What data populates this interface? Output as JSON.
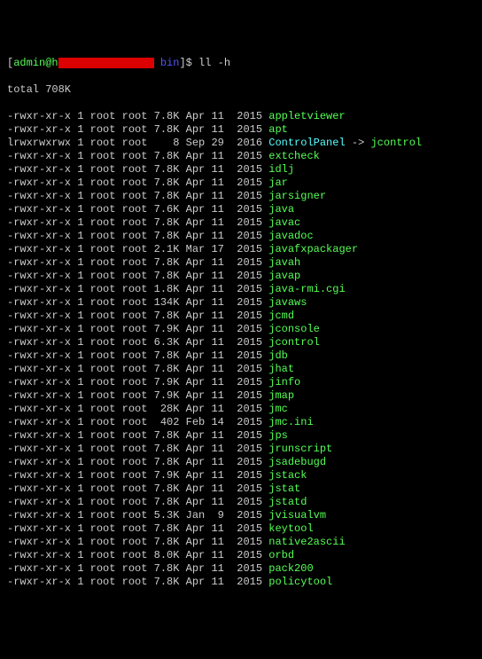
{
  "prompt": {
    "user": "admin",
    "at": "@",
    "host_prefix": "h",
    "path": "bin",
    "symbol": "$",
    "command": "ll -h"
  },
  "total": "total 708K",
  "rows": [
    {
      "perm": "-rwxr-xr-x",
      "links": "1",
      "owner": "root",
      "group": "root",
      "size": "7.8K",
      "mon": "Apr",
      "day": "11",
      "year": "2015",
      "name": "appletviewer",
      "type": "exec"
    },
    {
      "perm": "-rwxr-xr-x",
      "links": "1",
      "owner": "root",
      "group": "root",
      "size": "7.8K",
      "mon": "Apr",
      "day": "11",
      "year": "2015",
      "name": "apt",
      "type": "exec"
    },
    {
      "perm": "lrwxrwxrwx",
      "links": "1",
      "owner": "root",
      "group": "root",
      "size": "8",
      "mon": "Sep",
      "day": "29",
      "year": "2016",
      "name": "ControlPanel",
      "type": "link",
      "target": "jcontrol"
    },
    {
      "perm": "-rwxr-xr-x",
      "links": "1",
      "owner": "root",
      "group": "root",
      "size": "7.8K",
      "mon": "Apr",
      "day": "11",
      "year": "2015",
      "name": "extcheck",
      "type": "exec"
    },
    {
      "perm": "-rwxr-xr-x",
      "links": "1",
      "owner": "root",
      "group": "root",
      "size": "7.8K",
      "mon": "Apr",
      "day": "11",
      "year": "2015",
      "name": "idlj",
      "type": "exec"
    },
    {
      "perm": "-rwxr-xr-x",
      "links": "1",
      "owner": "root",
      "group": "root",
      "size": "7.8K",
      "mon": "Apr",
      "day": "11",
      "year": "2015",
      "name": "jar",
      "type": "exec"
    },
    {
      "perm": "-rwxr-xr-x",
      "links": "1",
      "owner": "root",
      "group": "root",
      "size": "7.8K",
      "mon": "Apr",
      "day": "11",
      "year": "2015",
      "name": "jarsigner",
      "type": "exec"
    },
    {
      "perm": "-rwxr-xr-x",
      "links": "1",
      "owner": "root",
      "group": "root",
      "size": "7.6K",
      "mon": "Apr",
      "day": "11",
      "year": "2015",
      "name": "java",
      "type": "exec"
    },
    {
      "perm": "-rwxr-xr-x",
      "links": "1",
      "owner": "root",
      "group": "root",
      "size": "7.8K",
      "mon": "Apr",
      "day": "11",
      "year": "2015",
      "name": "javac",
      "type": "exec"
    },
    {
      "perm": "-rwxr-xr-x",
      "links": "1",
      "owner": "root",
      "group": "root",
      "size": "7.8K",
      "mon": "Apr",
      "day": "11",
      "year": "2015",
      "name": "javadoc",
      "type": "exec"
    },
    {
      "perm": "-rwxr-xr-x",
      "links": "1",
      "owner": "root",
      "group": "root",
      "size": "2.1K",
      "mon": "Mar",
      "day": "17",
      "year": "2015",
      "name": "javafxpackager",
      "type": "exec"
    },
    {
      "perm": "-rwxr-xr-x",
      "links": "1",
      "owner": "root",
      "group": "root",
      "size": "7.8K",
      "mon": "Apr",
      "day": "11",
      "year": "2015",
      "name": "javah",
      "type": "exec"
    },
    {
      "perm": "-rwxr-xr-x",
      "links": "1",
      "owner": "root",
      "group": "root",
      "size": "7.8K",
      "mon": "Apr",
      "day": "11",
      "year": "2015",
      "name": "javap",
      "type": "exec"
    },
    {
      "perm": "-rwxr-xr-x",
      "links": "1",
      "owner": "root",
      "group": "root",
      "size": "1.8K",
      "mon": "Apr",
      "day": "11",
      "year": "2015",
      "name": "java-rmi.cgi",
      "type": "exec"
    },
    {
      "perm": "-rwxr-xr-x",
      "links": "1",
      "owner": "root",
      "group": "root",
      "size": "134K",
      "mon": "Apr",
      "day": "11",
      "year": "2015",
      "name": "javaws",
      "type": "exec"
    },
    {
      "perm": "-rwxr-xr-x",
      "links": "1",
      "owner": "root",
      "group": "root",
      "size": "7.8K",
      "mon": "Apr",
      "day": "11",
      "year": "2015",
      "name": "jcmd",
      "type": "exec"
    },
    {
      "perm": "-rwxr-xr-x",
      "links": "1",
      "owner": "root",
      "group": "root",
      "size": "7.9K",
      "mon": "Apr",
      "day": "11",
      "year": "2015",
      "name": "jconsole",
      "type": "exec"
    },
    {
      "perm": "-rwxr-xr-x",
      "links": "1",
      "owner": "root",
      "group": "root",
      "size": "6.3K",
      "mon": "Apr",
      "day": "11",
      "year": "2015",
      "name": "jcontrol",
      "type": "exec"
    },
    {
      "perm": "-rwxr-xr-x",
      "links": "1",
      "owner": "root",
      "group": "root",
      "size": "7.8K",
      "mon": "Apr",
      "day": "11",
      "year": "2015",
      "name": "jdb",
      "type": "exec"
    },
    {
      "perm": "-rwxr-xr-x",
      "links": "1",
      "owner": "root",
      "group": "root",
      "size": "7.8K",
      "mon": "Apr",
      "day": "11",
      "year": "2015",
      "name": "jhat",
      "type": "exec"
    },
    {
      "perm": "-rwxr-xr-x",
      "links": "1",
      "owner": "root",
      "group": "root",
      "size": "7.9K",
      "mon": "Apr",
      "day": "11",
      "year": "2015",
      "name": "jinfo",
      "type": "exec"
    },
    {
      "perm": "-rwxr-xr-x",
      "links": "1",
      "owner": "root",
      "group": "root",
      "size": "7.9K",
      "mon": "Apr",
      "day": "11",
      "year": "2015",
      "name": "jmap",
      "type": "exec"
    },
    {
      "perm": "-rwxr-xr-x",
      "links": "1",
      "owner": "root",
      "group": "root",
      "size": "28K",
      "mon": "Apr",
      "day": "11",
      "year": "2015",
      "name": "jmc",
      "type": "exec"
    },
    {
      "perm": "-rwxr-xr-x",
      "links": "1",
      "owner": "root",
      "group": "root",
      "size": "402",
      "mon": "Feb",
      "day": "14",
      "year": "2015",
      "name": "jmc.ini",
      "type": "exec"
    },
    {
      "perm": "-rwxr-xr-x",
      "links": "1",
      "owner": "root",
      "group": "root",
      "size": "7.8K",
      "mon": "Apr",
      "day": "11",
      "year": "2015",
      "name": "jps",
      "type": "exec"
    },
    {
      "perm": "-rwxr-xr-x",
      "links": "1",
      "owner": "root",
      "group": "root",
      "size": "7.8K",
      "mon": "Apr",
      "day": "11",
      "year": "2015",
      "name": "jrunscript",
      "type": "exec"
    },
    {
      "perm": "-rwxr-xr-x",
      "links": "1",
      "owner": "root",
      "group": "root",
      "size": "7.8K",
      "mon": "Apr",
      "day": "11",
      "year": "2015",
      "name": "jsadebugd",
      "type": "exec"
    },
    {
      "perm": "-rwxr-xr-x",
      "links": "1",
      "owner": "root",
      "group": "root",
      "size": "7.9K",
      "mon": "Apr",
      "day": "11",
      "year": "2015",
      "name": "jstack",
      "type": "exec"
    },
    {
      "perm": "-rwxr-xr-x",
      "links": "1",
      "owner": "root",
      "group": "root",
      "size": "7.8K",
      "mon": "Apr",
      "day": "11",
      "year": "2015",
      "name": "jstat",
      "type": "exec"
    },
    {
      "perm": "-rwxr-xr-x",
      "links": "1",
      "owner": "root",
      "group": "root",
      "size": "7.8K",
      "mon": "Apr",
      "day": "11",
      "year": "2015",
      "name": "jstatd",
      "type": "exec"
    },
    {
      "perm": "-rwxr-xr-x",
      "links": "1",
      "owner": "root",
      "group": "root",
      "size": "5.3K",
      "mon": "Jan",
      "day": "9",
      "year": "2015",
      "name": "jvisualvm",
      "type": "exec"
    },
    {
      "perm": "-rwxr-xr-x",
      "links": "1",
      "owner": "root",
      "group": "root",
      "size": "7.8K",
      "mon": "Apr",
      "day": "11",
      "year": "2015",
      "name": "keytool",
      "type": "exec"
    },
    {
      "perm": "-rwxr-xr-x",
      "links": "1",
      "owner": "root",
      "group": "root",
      "size": "7.8K",
      "mon": "Apr",
      "day": "11",
      "year": "2015",
      "name": "native2ascii",
      "type": "exec"
    },
    {
      "perm": "-rwxr-xr-x",
      "links": "1",
      "owner": "root",
      "group": "root",
      "size": "8.0K",
      "mon": "Apr",
      "day": "11",
      "year": "2015",
      "name": "orbd",
      "type": "exec"
    },
    {
      "perm": "-rwxr-xr-x",
      "links": "1",
      "owner": "root",
      "group": "root",
      "size": "7.8K",
      "mon": "Apr",
      "day": "11",
      "year": "2015",
      "name": "pack200",
      "type": "exec"
    },
    {
      "perm": "-rwxr-xr-x",
      "links": "1",
      "owner": "root",
      "group": "root",
      "size": "7.8K",
      "mon": "Apr",
      "day": "11",
      "year": "2015",
      "name": "policytool",
      "type": "exec"
    }
  ]
}
